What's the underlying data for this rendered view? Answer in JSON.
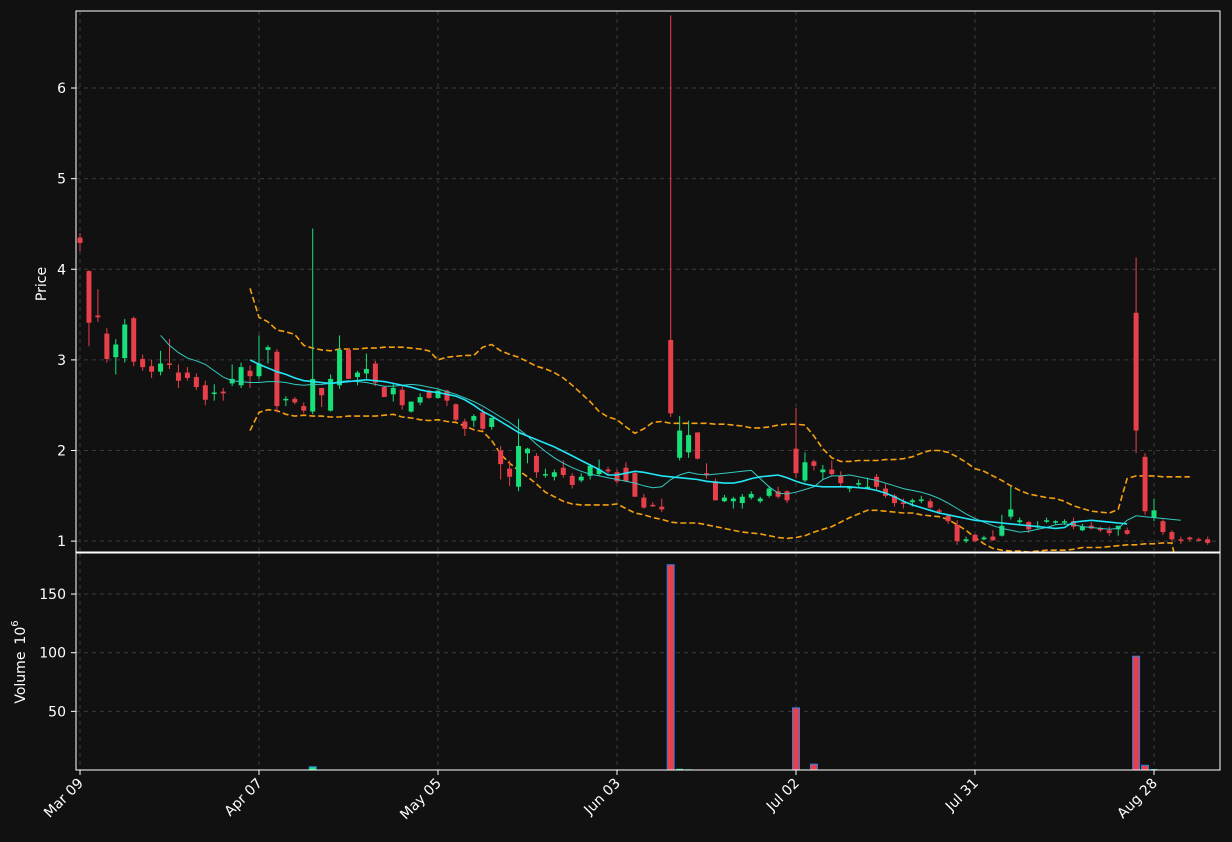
{
  "chart_data": {
    "type": "candlestick",
    "panels": [
      {
        "name": "price",
        "ylabel": "Price",
        "ylim": [
          0.88,
          6.85
        ],
        "yticks": [
          1,
          2,
          3,
          4,
          5,
          6
        ],
        "grid": true,
        "series": [
          {
            "kind": "candles"
          },
          {
            "kind": "line",
            "ref": "ma_short"
          },
          {
            "kind": "line",
            "ref": "ma_long"
          },
          {
            "kind": "dashed-band",
            "ref": "bollinger"
          }
        ]
      },
      {
        "name": "volume",
        "ylabel": "Volume",
        "ylabel_exponent": "10",
        "ylabel_exponent_power": "6",
        "ylim": [
          0,
          185
        ],
        "yticks": [
          50,
          100,
          150
        ],
        "grid": true
      }
    ],
    "x_tick_labels": [
      {
        "index": 0,
        "label": "Mar 09"
      },
      {
        "index": 20,
        "label": "Apr 07"
      },
      {
        "index": 40,
        "label": "May 05"
      },
      {
        "index": 60,
        "label": "Jun 03"
      },
      {
        "index": 80,
        "label": "Jul 02"
      },
      {
        "index": 100,
        "label": "Jul 31"
      },
      {
        "index": 120,
        "label": "Aug 28"
      }
    ],
    "colors": {
      "background": "#111111",
      "up": "#17e07a",
      "down": "#e8404a",
      "ma_short": "#35c9c0",
      "ma_long": "#22e6f6",
      "band": "#f5a00f",
      "volume_bar_edge": "#2f7de1",
      "grid": "#3a3a3a",
      "axis": "#ffffff"
    },
    "candles": [
      [
        4.35,
        4.4,
        4.2,
        4.29,
        0.3
      ],
      [
        3.98,
        3.99,
        3.15,
        3.41,
        0.4
      ],
      [
        3.49,
        3.78,
        3.42,
        3.47,
        0.3
      ],
      [
        3.29,
        3.35,
        2.97,
        3.01,
        0.3
      ],
      [
        3.03,
        3.23,
        2.84,
        3.17,
        0.3
      ],
      [
        3.02,
        3.45,
        2.97,
        3.39,
        0.3
      ],
      [
        3.46,
        3.48,
        2.93,
        2.98,
        0.3
      ],
      [
        3.01,
        3.06,
        2.88,
        2.92,
        0.3
      ],
      [
        2.93,
        3.0,
        2.8,
        2.87,
        0.3
      ],
      [
        2.87,
        3.1,
        2.83,
        2.96,
        0.3
      ],
      [
        2.96,
        3.23,
        2.9,
        2.95,
        0.3
      ],
      [
        2.86,
        2.95,
        2.69,
        2.77,
        0.3
      ],
      [
        2.86,
        2.92,
        2.77,
        2.8,
        0.3
      ],
      [
        2.81,
        2.85,
        2.67,
        2.7,
        0.3
      ],
      [
        2.72,
        2.77,
        2.5,
        2.56,
        0.3
      ],
      [
        2.64,
        2.73,
        2.55,
        2.64,
        0.3
      ],
      [
        2.65,
        2.69,
        2.55,
        2.63,
        0.3
      ],
      [
        2.74,
        2.95,
        2.71,
        2.79,
        0.3
      ],
      [
        2.72,
        2.97,
        2.69,
        2.92,
        0.3
      ],
      [
        2.88,
        2.94,
        2.69,
        2.82,
        0.3
      ],
      [
        2.82,
        3.27,
        2.79,
        2.96,
        0.3
      ],
      [
        3.11,
        3.16,
        2.96,
        3.14,
        0.3
      ],
      [
        3.09,
        3.12,
        2.42,
        2.49,
        0.3
      ],
      [
        2.57,
        2.6,
        2.49,
        2.57,
        0.3
      ],
      [
        2.57,
        2.59,
        2.51,
        2.53,
        0.3
      ],
      [
        2.49,
        2.53,
        2.41,
        2.44,
        0.3
      ],
      [
        2.43,
        4.45,
        2.4,
        2.79,
        2.8
      ],
      [
        2.69,
        2.69,
        2.48,
        2.61,
        0.3
      ],
      [
        2.44,
        2.84,
        2.43,
        2.79,
        0.3
      ],
      [
        2.72,
        3.27,
        2.68,
        3.11,
        0.3
      ],
      [
        3.11,
        3.13,
        2.79,
        2.79,
        0.3
      ],
      [
        2.81,
        2.88,
        2.72,
        2.86,
        0.3
      ],
      [
        2.85,
        3.07,
        2.79,
        2.9,
        0.3
      ],
      [
        2.96,
        2.99,
        2.71,
        2.75,
        0.3
      ],
      [
        2.7,
        2.71,
        2.59,
        2.59,
        0.3
      ],
      [
        2.62,
        2.74,
        2.54,
        2.69,
        0.3
      ],
      [
        2.67,
        2.71,
        2.45,
        2.5,
        0.3
      ],
      [
        2.43,
        2.54,
        2.42,
        2.54,
        0.3
      ],
      [
        2.53,
        2.63,
        2.5,
        2.59,
        0.3
      ],
      [
        2.66,
        2.67,
        2.57,
        2.58,
        0.3
      ],
      [
        2.58,
        2.67,
        2.57,
        2.66,
        0.3
      ],
      [
        2.66,
        2.67,
        2.49,
        2.55,
        0.3
      ],
      [
        2.51,
        2.52,
        2.32,
        2.34,
        0.3
      ],
      [
        2.32,
        2.35,
        2.16,
        2.24,
        0.3
      ],
      [
        2.33,
        2.4,
        2.26,
        2.38,
        0.3
      ],
      [
        2.42,
        2.46,
        2.22,
        2.24,
        0.3
      ],
      [
        2.26,
        2.36,
        2.23,
        2.36,
        0.3
      ],
      [
        2.0,
        2.05,
        1.68,
        1.85,
        0.3
      ],
      [
        1.8,
        1.89,
        1.61,
        1.71,
        0.3
      ],
      [
        1.6,
        2.35,
        1.55,
        2.05,
        0.3
      ],
      [
        1.97,
        2.03,
        1.86,
        2.02,
        0.3
      ],
      [
        1.94,
        1.97,
        1.7,
        1.76,
        0.3
      ],
      [
        1.73,
        1.8,
        1.7,
        1.74,
        0.3
      ],
      [
        1.71,
        1.79,
        1.67,
        1.76,
        0.3
      ],
      [
        1.81,
        1.89,
        1.7,
        1.73,
        0.3
      ],
      [
        1.72,
        1.75,
        1.58,
        1.62,
        0.3
      ],
      [
        1.67,
        1.75,
        1.65,
        1.71,
        0.3
      ],
      [
        1.72,
        1.85,
        1.68,
        1.83,
        0.3
      ],
      [
        1.74,
        1.9,
        1.72,
        1.79,
        0.3
      ],
      [
        1.79,
        1.82,
        1.73,
        1.77,
        0.3
      ],
      [
        1.76,
        1.79,
        1.64,
        1.66,
        0.3
      ],
      [
        1.81,
        1.87,
        1.69,
        1.66,
        0.3
      ],
      [
        1.75,
        1.77,
        1.49,
        1.49,
        0.3
      ],
      [
        1.48,
        1.52,
        1.36,
        1.37,
        0.3
      ],
      [
        1.4,
        1.43,
        1.38,
        1.39,
        0.3
      ],
      [
        1.38,
        1.47,
        1.32,
        1.35,
        0.3
      ],
      [
        3.22,
        6.8,
        2.37,
        2.41,
        175
      ],
      [
        1.92,
        2.38,
        1.89,
        2.22,
        1.0
      ],
      [
        1.98,
        2.33,
        1.92,
        2.17,
        0.6
      ],
      [
        2.2,
        2.2,
        1.9,
        1.91,
        0.3
      ],
      [
        1.75,
        1.86,
        1.69,
        1.73,
        0.3
      ],
      [
        1.66,
        1.69,
        1.45,
        1.45,
        0.3
      ],
      [
        1.44,
        1.51,
        1.43,
        1.48,
        0.3
      ],
      [
        1.44,
        1.49,
        1.36,
        1.47,
        0.3
      ],
      [
        1.42,
        1.52,
        1.36,
        1.49,
        0.3
      ],
      [
        1.48,
        1.55,
        1.46,
        1.52,
        0.3
      ],
      [
        1.44,
        1.49,
        1.42,
        1.47,
        0.3
      ],
      [
        1.5,
        1.61,
        1.48,
        1.58,
        0.3
      ],
      [
        1.55,
        1.6,
        1.47,
        1.49,
        0.3
      ],
      [
        1.55,
        1.56,
        1.42,
        1.45,
        0.3
      ],
      [
        2.02,
        2.47,
        1.7,
        1.75,
        53
      ],
      [
        1.67,
        1.98,
        1.65,
        1.87,
        0.5
      ],
      [
        1.88,
        1.9,
        1.78,
        1.83,
        5.0
      ],
      [
        1.76,
        1.84,
        1.68,
        1.79,
        0.3
      ],
      [
        1.79,
        1.89,
        1.72,
        1.74,
        0.3
      ],
      [
        1.72,
        1.77,
        1.6,
        1.64,
        0.3
      ],
      [
        1.58,
        1.61,
        1.54,
        1.6,
        0.3
      ],
      [
        1.64,
        1.68,
        1.6,
        1.64,
        0.3
      ],
      [
        1.6,
        1.7,
        1.57,
        1.6,
        0.3
      ],
      [
        1.71,
        1.74,
        1.57,
        1.6,
        0.3
      ],
      [
        1.58,
        1.63,
        1.48,
        1.5,
        0.3
      ],
      [
        1.5,
        1.52,
        1.38,
        1.42,
        0.3
      ],
      [
        1.43,
        1.47,
        1.36,
        1.41,
        0.3
      ],
      [
        1.43,
        1.47,
        1.38,
        1.45,
        0.3
      ],
      [
        1.46,
        1.5,
        1.42,
        1.46,
        0.3
      ],
      [
        1.44,
        1.47,
        1.36,
        1.37,
        0.3
      ],
      [
        1.34,
        1.36,
        1.3,
        1.33,
        0.3
      ],
      [
        1.28,
        1.3,
        1.19,
        1.22,
        0.3
      ],
      [
        1.18,
        1.23,
        0.96,
        1.0,
        0.3
      ],
      [
        1.0,
        1.05,
        0.98,
        1.02,
        0.3
      ],
      [
        1.07,
        1.08,
        0.99,
        1.0,
        0.3
      ],
      [
        1.02,
        1.06,
        1.01,
        1.04,
        0.3
      ],
      [
        1.05,
        1.12,
        1.0,
        1.01,
        0.3
      ],
      [
        1.06,
        1.29,
        1.05,
        1.17,
        0.3
      ],
      [
        1.27,
        1.6,
        1.24,
        1.35,
        0.3
      ],
      [
        1.21,
        1.26,
        1.19,
        1.23,
        0.3
      ],
      [
        1.21,
        1.22,
        1.09,
        1.13,
        0.3
      ],
      [
        1.17,
        1.22,
        1.14,
        1.17,
        0.3
      ],
      [
        1.22,
        1.26,
        1.2,
        1.23,
        0.3
      ],
      [
        1.22,
        1.23,
        1.19,
        1.22,
        0.3
      ],
      [
        1.21,
        1.24,
        1.18,
        1.22,
        0.3
      ],
      [
        1.22,
        1.26,
        1.13,
        1.16,
        0.3
      ],
      [
        1.12,
        1.19,
        1.11,
        1.16,
        0.3
      ],
      [
        1.17,
        1.21,
        1.13,
        1.14,
        0.3
      ],
      [
        1.14,
        1.16,
        1.1,
        1.12,
        0.3
      ],
      [
        1.12,
        1.16,
        1.06,
        1.09,
        0.3
      ],
      [
        1.13,
        1.16,
        1.06,
        1.17,
        0.3
      ],
      [
        1.12,
        1.15,
        1.07,
        1.08,
        0.3
      ],
      [
        3.52,
        4.13,
        1.97,
        2.22,
        97
      ],
      [
        1.93,
        1.97,
        1.29,
        1.33,
        4.0
      ],
      [
        1.26,
        1.47,
        1.22,
        1.34,
        0.8
      ],
      [
        1.22,
        1.24,
        1.07,
        1.1,
        0.3
      ],
      [
        1.1,
        1.12,
        1.0,
        1.02,
        0.3
      ],
      [
        1.02,
        1.05,
        0.97,
        1.01,
        0.3
      ],
      [
        1.04,
        1.05,
        1.0,
        1.02,
        0.3
      ],
      [
        1.02,
        1.04,
        1.0,
        1.01,
        0.3
      ],
      [
        1.02,
        1.05,
        0.96,
        0.98,
        0.3
      ]
    ],
    "ma_short": {
      "start_index": 9,
      "values": [
        3.27,
        3.16,
        3.08,
        3.02,
        2.99,
        2.95,
        2.88,
        2.81,
        2.77,
        2.76,
        2.75,
        2.75,
        2.76,
        2.76,
        2.75,
        2.73,
        2.72,
        2.73,
        2.73,
        2.74,
        2.76,
        2.77,
        2.76,
        2.75,
        2.73,
        2.71,
        2.71,
        2.72,
        2.73,
        2.72,
        2.7,
        2.68,
        2.65,
        2.62,
        2.58,
        2.54,
        2.49,
        2.43,
        2.37,
        2.31,
        2.24,
        2.16,
        2.07,
        1.99,
        1.92,
        1.86,
        1.81,
        1.77,
        1.74,
        1.72,
        1.7,
        1.68,
        1.66,
        1.64,
        1.61,
        1.59,
        1.6,
        1.68,
        1.73,
        1.76,
        1.74,
        1.73,
        1.74,
        1.75,
        1.76,
        1.77,
        1.78,
        1.69,
        1.6,
        1.53,
        1.52,
        1.54,
        1.57,
        1.6,
        1.68,
        1.72,
        1.72,
        1.73,
        1.71,
        1.69,
        1.67,
        1.64,
        1.61,
        1.58,
        1.56,
        1.54,
        1.51,
        1.47,
        1.42,
        1.36,
        1.3,
        1.25,
        1.21,
        1.17,
        1.14,
        1.12,
        1.1,
        1.11,
        1.13,
        1.15,
        1.18,
        1.19,
        1.18,
        1.16,
        1.15,
        1.14,
        1.13,
        1.14,
        1.23,
        1.28,
        1.27,
        1.26,
        1.25,
        1.24,
        1.23
      ]
    },
    "ma_long": {
      "start_index": 19,
      "values": [
        3.0,
        2.95,
        2.91,
        2.87,
        2.84,
        2.8,
        2.77,
        2.76,
        2.75,
        2.74,
        2.75,
        2.76,
        2.77,
        2.78,
        2.77,
        2.76,
        2.74,
        2.72,
        2.7,
        2.67,
        2.65,
        2.64,
        2.62,
        2.6,
        2.56,
        2.5,
        2.43,
        2.38,
        2.32,
        2.26,
        2.2,
        2.16,
        2.12,
        2.08,
        2.04,
        1.99,
        1.94,
        1.89,
        1.84,
        1.79,
        1.73,
        1.73,
        1.75,
        1.77,
        1.76,
        1.74,
        1.72,
        1.71,
        1.7,
        1.69,
        1.68,
        1.66,
        1.65,
        1.64,
        1.64,
        1.66,
        1.69,
        1.71,
        1.72,
        1.73,
        1.7,
        1.66,
        1.63,
        1.61,
        1.6,
        1.6,
        1.6,
        1.6,
        1.59,
        1.58,
        1.56,
        1.53,
        1.49,
        1.44,
        1.4,
        1.37,
        1.34,
        1.31,
        1.29,
        1.27,
        1.25,
        1.23,
        1.22,
        1.21,
        1.2,
        1.19,
        1.18,
        1.17,
        1.16,
        1.15,
        1.14,
        1.15,
        1.21,
        1.22,
        1.23,
        1.22,
        1.21,
        1.2,
        1.19
      ]
    },
    "bollinger": {
      "start_index": 19,
      "upper": [
        3.79,
        3.47,
        3.42,
        3.33,
        3.31,
        3.28,
        3.16,
        3.13,
        3.11,
        3.1,
        3.12,
        3.12,
        3.12,
        3.13,
        3.13,
        3.14,
        3.14,
        3.14,
        3.13,
        3.12,
        3.1,
        3.0,
        3.03,
        3.04,
        3.05,
        3.05,
        3.14,
        3.17,
        3.1,
        3.06,
        3.03,
        2.98,
        2.93,
        2.9,
        2.86,
        2.8,
        2.72,
        2.63,
        2.54,
        2.43,
        2.37,
        2.34,
        2.26,
        2.19,
        2.24,
        2.31,
        2.32,
        2.3,
        2.3,
        2.3,
        2.3,
        2.3,
        2.29,
        2.29,
        2.28,
        2.27,
        2.25,
        2.25,
        2.26,
        2.28,
        2.29,
        2.29,
        2.28,
        2.16,
        2.02,
        1.92,
        1.88,
        1.88,
        1.89,
        1.89,
        1.89,
        1.9,
        1.9,
        1.91,
        1.93,
        1.97,
        2.0,
        2.0,
        1.98,
        1.93,
        1.87,
        1.8,
        1.77,
        1.72,
        1.67,
        1.61,
        1.56,
        1.52,
        1.5,
        1.48,
        1.47,
        1.44,
        1.39,
        1.36,
        1.33,
        1.32,
        1.31,
        1.35,
        1.69,
        1.72,
        1.72,
        1.72,
        1.71,
        1.71,
        1.71,
        1.71
      ],
      "lower": [
        2.22,
        2.42,
        2.45,
        2.44,
        2.4,
        2.38,
        2.39,
        2.38,
        2.38,
        2.37,
        2.37,
        2.38,
        2.38,
        2.38,
        2.38,
        2.39,
        2.4,
        2.37,
        2.36,
        2.34,
        2.33,
        2.34,
        2.32,
        2.31,
        2.27,
        2.23,
        2.21,
        2.11,
        1.96,
        1.86,
        1.78,
        1.71,
        1.63,
        1.54,
        1.49,
        1.44,
        1.41,
        1.4,
        1.4,
        1.4,
        1.4,
        1.41,
        1.36,
        1.31,
        1.29,
        1.26,
        1.24,
        1.21,
        1.2,
        1.2,
        1.2,
        1.18,
        1.16,
        1.14,
        1.12,
        1.1,
        1.09,
        1.08,
        1.06,
        1.04,
        1.03,
        1.04,
        1.06,
        1.1,
        1.13,
        1.16,
        1.21,
        1.26,
        1.3,
        1.34,
        1.34,
        1.33,
        1.32,
        1.31,
        1.31,
        1.29,
        1.28,
        1.27,
        1.24,
        1.18,
        1.12,
        1.04,
        0.97,
        0.92,
        0.9,
        0.89,
        0.89,
        0.88,
        0.89,
        0.9,
        0.9,
        0.9,
        0.91,
        0.93,
        0.93,
        0.93,
        0.94,
        0.95,
        0.96,
        0.96,
        0.97,
        0.97,
        0.98,
        0.98,
        0.5
      ]
    }
  }
}
